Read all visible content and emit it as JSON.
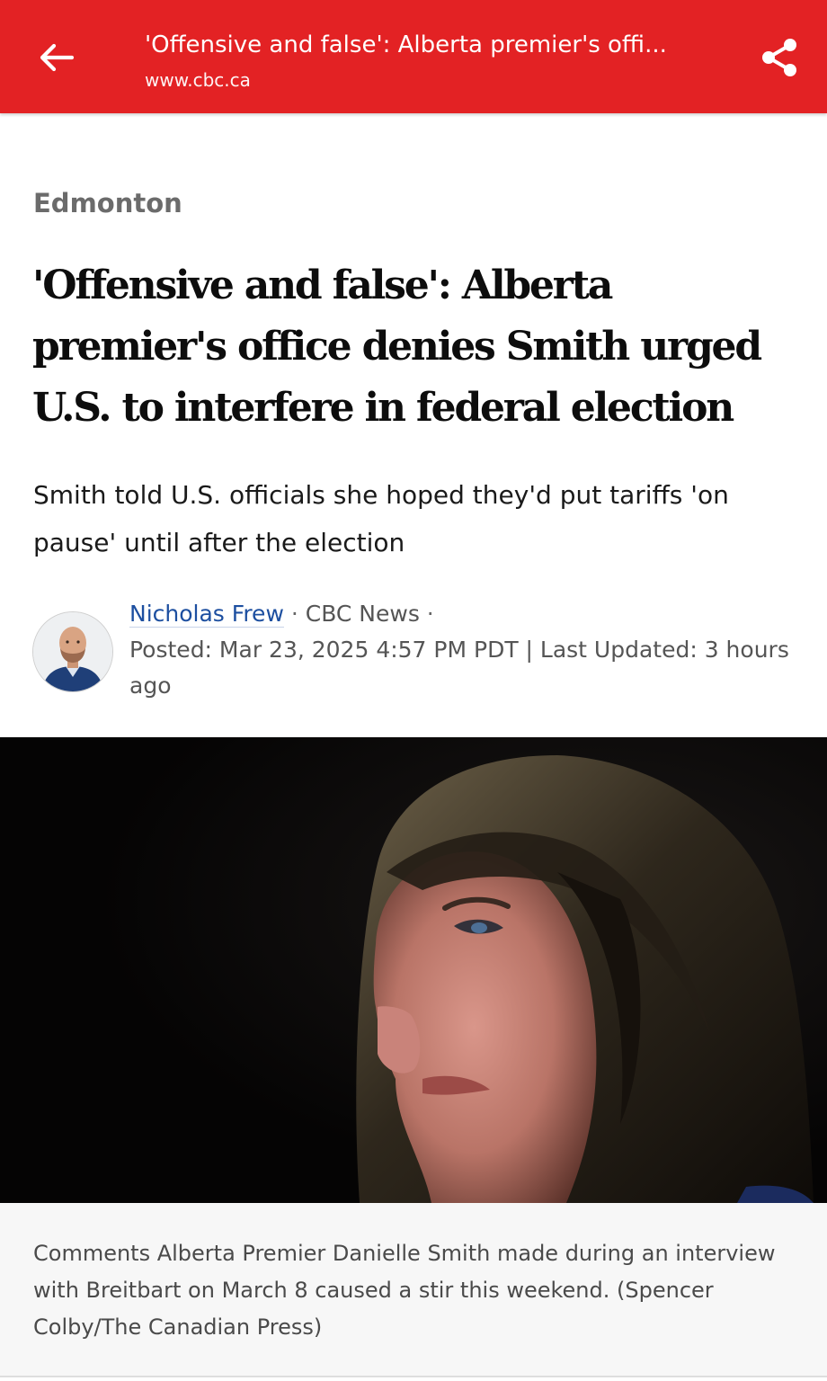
{
  "topbar": {
    "back_icon": "arrow-left-icon",
    "title": "'Offensive and false': Alberta premier's offi...",
    "url": "www.cbc.ca",
    "share_icon": "share-icon",
    "background_color": "#e32224"
  },
  "article": {
    "section": "Edmonton",
    "headline": "'Offensive and false': Alberta premier's office denies Smith urged U.S. to interfere in federal election",
    "deck": "Smith told U.S. officials she hoped they'd put tariffs 'on pause' until after the election",
    "byline": {
      "author": "Nicholas Frew",
      "separator": " · ",
      "outlet": "CBC News",
      "trailing_separator": " ·",
      "posted": "Posted: Mar 23, 2025 4:57 PM PDT | Last Updated: 3 hours ago",
      "author_link_color": "#1d4fa0"
    },
    "image": {
      "caption": "Comments Alberta Premier Danielle Smith made during an interview with Breitbart on March 8 caused a stir this weekend. (Spencer Colby/The Canadian Press)"
    }
  }
}
